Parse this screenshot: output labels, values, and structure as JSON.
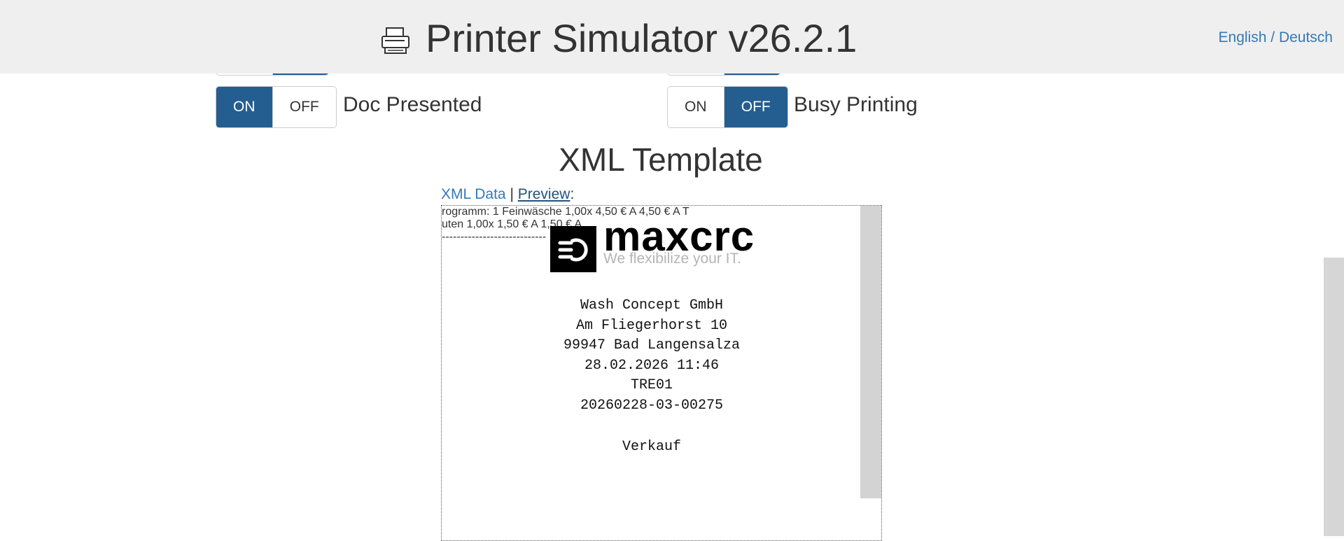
{
  "header": {
    "title": "Printer Simulator v26.2.1",
    "lang_english": "English",
    "lang_separator": "/",
    "lang_deutsch": "Deutsch"
  },
  "toggles": [
    {
      "on": "ON",
      "off": "OFF",
      "label": "Doc Presented",
      "state": "on"
    },
    {
      "on": "ON",
      "off": "OFF",
      "label": "Busy Printing",
      "state": "off"
    }
  ],
  "section_title": "XML Template",
  "tabs": {
    "xml_data": "XML Data",
    "pipe": "|",
    "preview": "Preview",
    "colon": ":"
  },
  "receipt": {
    "logo_word": "maxcrc",
    "logo_slogan": "We flexibilize your IT.",
    "company": "Wash Concept GmbH",
    "street": "Am Fliegerhorst 10",
    "city": "99947 Bad Langensalza",
    "datetime": "28.02.2026 11:46",
    "terminal": "TRE01",
    "receipt_no": "20260228-03-00275",
    "type": "Verkauf",
    "item1": "rogramm: 1 Feinwäsche  1,00x 4,50 € A 4,50 € A T",
    "item2": "uten  1,00x 1,50 € A 1,50 € A",
    "divider": "----------------------------"
  },
  "colors": {
    "active_toggle": "#245e91",
    "link": "#337ab7",
    "header_bg": "#efefef"
  }
}
